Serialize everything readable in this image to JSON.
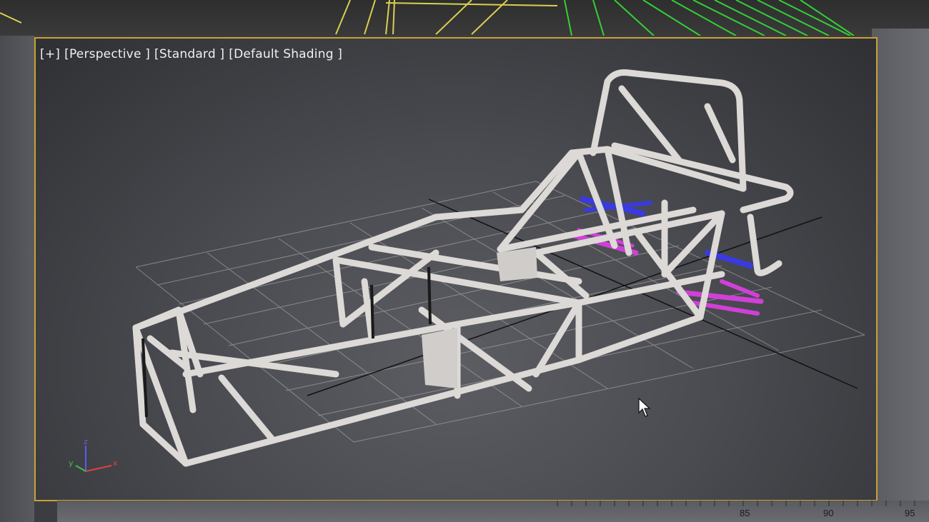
{
  "viewport": {
    "labels": [
      "[+]",
      "[Perspective ]",
      "[Standard ]",
      "[Default Shading ]"
    ]
  },
  "axis_gizmo": {
    "x": "x",
    "y": "y",
    "z": "z"
  },
  "timeline": {
    "ticks": [
      "85",
      "90",
      "95"
    ]
  },
  "colors": {
    "viewport_border": "#c9a233",
    "frame": "#dcd9d6",
    "suspension_blue": "#3a3ae0",
    "suspension_magenta": "#d040d8",
    "grid": "#bdbdbd",
    "top_wire_green": "#33d033",
    "top_wire_yellow": "#d8d050"
  },
  "icons": {
    "cursor": "mouse-pointer-icon",
    "gizmo": "axis-gizmo-icon"
  }
}
